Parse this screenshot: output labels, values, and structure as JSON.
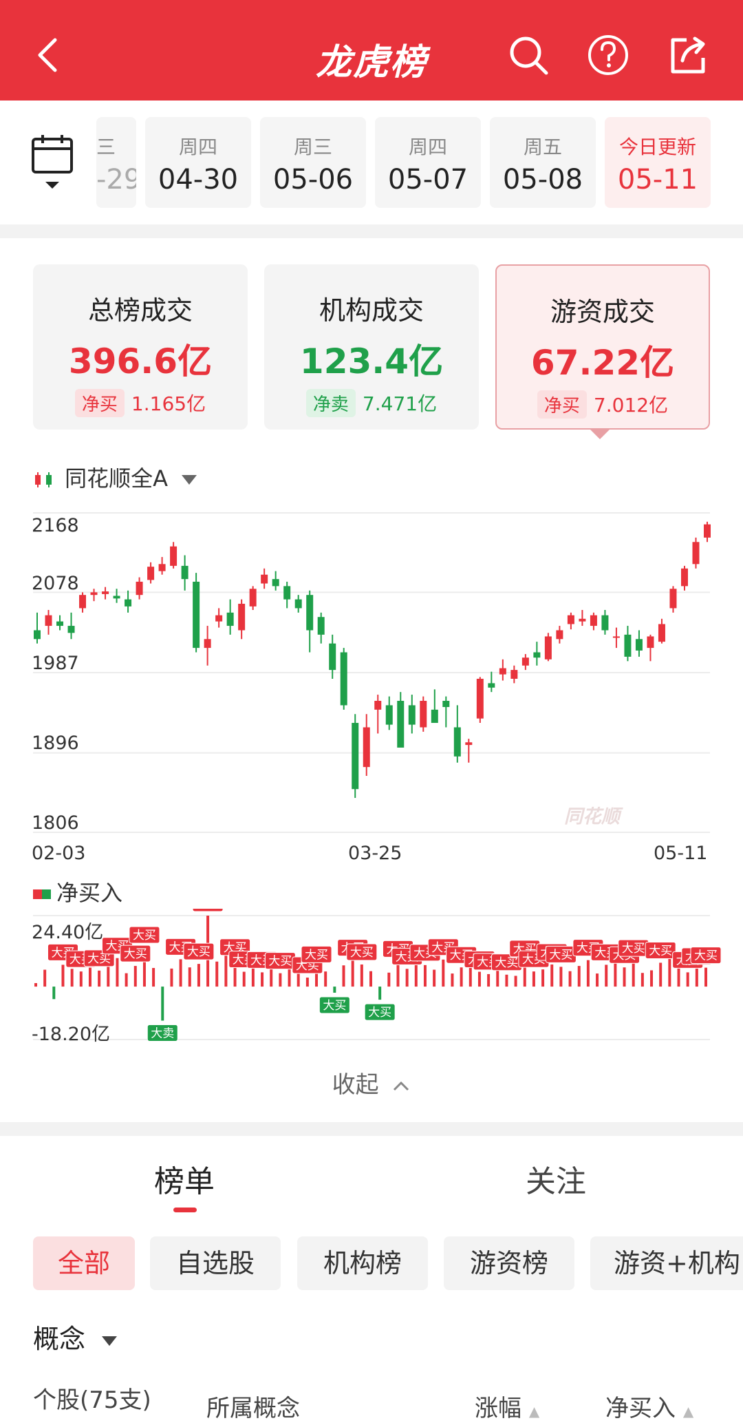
{
  "header": {
    "title": "龙虎榜",
    "back_icon": "back-arrow-icon",
    "icons": [
      "search-icon",
      "help-icon",
      "share-icon"
    ]
  },
  "dates": [
    {
      "week": "三",
      "date": "-29"
    },
    {
      "week": "周四",
      "date": "04-30"
    },
    {
      "week": "周三",
      "date": "05-06"
    },
    {
      "week": "周四",
      "date": "05-07"
    },
    {
      "week": "周五",
      "date": "05-08"
    },
    {
      "week": "今日更新",
      "date": "05-11"
    }
  ],
  "cards": [
    {
      "title": "总榜成交",
      "value": "396.6亿",
      "net_label": "净买",
      "net_value": "1.165亿"
    },
    {
      "title": "机构成交",
      "value": "123.4亿",
      "net_label": "净卖",
      "net_value": "7.471亿"
    },
    {
      "title": "游资成交",
      "value": "67.22亿",
      "net_label": "净买",
      "net_value": "7.012亿"
    }
  ],
  "index_selector": "同花顺全A",
  "watermark": "同花顺",
  "flow_label": "净买入",
  "collapse_label": "收起",
  "list_tabs": [
    "榜单",
    "关注"
  ],
  "filters": [
    "全部",
    "自选股",
    "机构榜",
    "游资榜",
    "游资+机构"
  ],
  "concept_label": "概念",
  "table_headers": [
    "个股(75支)",
    "所属概念",
    "涨幅",
    "净买入"
  ],
  "chart_data": [
    {
      "type": "candlestick",
      "title": "同花顺全A",
      "y_ticks": [
        "2168",
        "2078",
        "1987",
        "1896",
        "1806"
      ],
      "ylim": [
        1806,
        2168
      ],
      "x_ticks": [
        "02-03",
        "03-25",
        "05-11"
      ],
      "ohlc": [
        [
          2035,
          2055,
          2020,
          2025
        ],
        [
          2040,
          2058,
          2030,
          2052
        ],
        [
          2045,
          2052,
          2035,
          2040
        ],
        [
          2040,
          2055,
          2025,
          2032
        ],
        [
          2060,
          2078,
          2055,
          2075
        ],
        [
          2075,
          2082,
          2068,
          2078
        ],
        [
          2076,
          2084,
          2070,
          2079
        ],
        [
          2074,
          2082,
          2066,
          2071
        ],
        [
          2070,
          2080,
          2055,
          2062
        ],
        [
          2075,
          2095,
          2070,
          2090
        ],
        [
          2092,
          2112,
          2088,
          2107
        ],
        [
          2102,
          2118,
          2098,
          2110
        ],
        [
          2108,
          2135,
          2105,
          2130
        ],
        [
          2108,
          2120,
          2080,
          2093
        ],
        [
          2090,
          2100,
          2010,
          2015
        ],
        [
          2015,
          2040,
          1995,
          2025
        ],
        [
          2045,
          2060,
          2038,
          2052
        ],
        [
          2055,
          2070,
          2030,
          2040
        ],
        [
          2035,
          2070,
          2025,
          2065
        ],
        [
          2062,
          2085,
          2058,
          2082
        ],
        [
          2088,
          2105,
          2082,
          2098
        ],
        [
          2093,
          2102,
          2080,
          2085
        ],
        [
          2085,
          2090,
          2060,
          2070
        ],
        [
          2070,
          2075,
          2055,
          2060
        ],
        [
          2075,
          2080,
          2010,
          2035
        ],
        [
          2050,
          2055,
          2020,
          2030
        ],
        [
          2020,
          2030,
          1980,
          1990
        ],
        [
          2010,
          2015,
          1945,
          1950
        ],
        [
          1930,
          1940,
          1845,
          1855
        ],
        [
          1880,
          1940,
          1870,
          1925
        ],
        [
          1945,
          1962,
          1918,
          1955
        ],
        [
          1950,
          1960,
          1922,
          1928
        ],
        [
          1955,
          1965,
          1918,
          1902
        ],
        [
          1950,
          1962,
          1918,
          1928
        ],
        [
          1925,
          1960,
          1920,
          1955
        ],
        [
          1945,
          1968,
          1935,
          1930
        ],
        [
          1955,
          1960,
          1925,
          1948
        ],
        [
          1925,
          1950,
          1885,
          1892
        ],
        [
          1905,
          1912,
          1885,
          1908
        ],
        [
          1935,
          1982,
          1930,
          1980
        ],
        [
          1975,
          1988,
          1965,
          1970
        ],
        [
          1985,
          2002,
          1978,
          1992
        ],
        [
          1980,
          1995,
          1975,
          1990
        ],
        [
          1995,
          2008,
          1990,
          2004
        ],
        [
          2010,
          2022,
          1995,
          2004
        ],
        [
          2002,
          2032,
          2000,
          2028
        ],
        [
          2025,
          2040,
          2020,
          2035
        ],
        [
          2042,
          2055,
          2036,
          2052
        ],
        [
          2045,
          2058,
          2040,
          2048
        ],
        [
          2040,
          2055,
          2035,
          2052
        ],
        [
          2052,
          2058,
          2030,
          2035
        ],
        [
          2028,
          2038,
          2015,
          2028
        ],
        [
          2030,
          2040,
          2000,
          2005
        ],
        [
          2025,
          2035,
          2005,
          2012
        ],
        [
          2015,
          2030,
          2000,
          2028
        ],
        [
          2022,
          2048,
          2020,
          2042
        ],
        [
          2060,
          2085,
          2055,
          2082
        ],
        [
          2085,
          2108,
          2080,
          2105
        ],
        [
          2110,
          2140,
          2105,
          2135
        ],
        [
          2140,
          2158,
          2135,
          2155
        ]
      ]
    },
    {
      "type": "bar",
      "title": "净买入",
      "y_ticks": [
        "24.40亿",
        "-18.20亿"
      ],
      "ylim": [
        -18.2,
        24.4
      ],
      "values": [
        1.2,
        5.8,
        -4.3,
        7.5,
        6.1,
        5.2,
        6.8,
        5.5,
        8.3,
        9.8,
        4.6,
        7.1,
        13.5,
        6.4,
        -11.7,
        6.2,
        9.4,
        6.6,
        7.8,
        24.4,
        8.6,
        12.4,
        9.3,
        5.1,
        7.8,
        4.9,
        8.2,
        4.6,
        6.4,
        4.4,
        3.1,
        6.8,
        5.2,
        -2.1,
        7.3,
        9.1,
        7.6,
        5.3,
        -4.5,
        4.8,
        8.7,
        6.1,
        11.6,
        7.4,
        5.8,
        9.3,
        4.5,
        6.6,
        7.9,
        5.1,
        4.3,
        9.7,
        4.1,
        3.7,
        8.8,
        5.2,
        5.9,
        7.6,
        6.8,
        5.3,
        7.1,
        9.1,
        4.5,
        7.5,
        10.2,
        6.6,
        9.0,
        4.7,
        5.6,
        8.2,
        9.6,
        8.8,
        4.9,
        6.2,
        6.5
      ],
      "tags": [
        {
          "i": 3,
          "label": "大买"
        },
        {
          "i": 5,
          "label": "大买"
        },
        {
          "i": 7,
          "label": "大买"
        },
        {
          "i": 9,
          "label": "大买"
        },
        {
          "i": 12,
          "label": "大买"
        },
        {
          "i": 11,
          "label": "大买"
        },
        {
          "i": 14,
          "label": "大卖"
        },
        {
          "i": 16,
          "label": "大买"
        },
        {
          "i": 18,
          "label": "大买"
        },
        {
          "i": 19,
          "label": "大买"
        },
        {
          "i": 22,
          "label": "大买"
        },
        {
          "i": 23,
          "label": "大买"
        },
        {
          "i": 25,
          "label": "大买"
        },
        {
          "i": 27,
          "label": "大买"
        },
        {
          "i": 30,
          "label": "大买"
        },
        {
          "i": 31,
          "label": "大买"
        },
        {
          "i": 33,
          "label": "大买"
        },
        {
          "i": 35,
          "label": "大买"
        },
        {
          "i": 36,
          "label": "大买"
        },
        {
          "i": 38,
          "label": "大买"
        },
        {
          "i": 40,
          "label": "大买"
        },
        {
          "i": 41,
          "label": "大买"
        },
        {
          "i": 43,
          "label": "大买"
        },
        {
          "i": 45,
          "label": "大买"
        },
        {
          "i": 47,
          "label": "大买"
        },
        {
          "i": 49,
          "label": "大买"
        },
        {
          "i": 50,
          "label": "大买"
        },
        {
          "i": 52,
          "label": "大买"
        },
        {
          "i": 54,
          "label": "大买"
        },
        {
          "i": 55,
          "label": "大买"
        },
        {
          "i": 57,
          "label": "大买"
        },
        {
          "i": 58,
          "label": "大买"
        },
        {
          "i": 61,
          "label": "大买"
        },
        {
          "i": 63,
          "label": "大买"
        },
        {
          "i": 65,
          "label": "大买"
        },
        {
          "i": 66,
          "label": "大买"
        },
        {
          "i": 69,
          "label": "大买"
        },
        {
          "i": 72,
          "label": "大买"
        },
        {
          "i": 73,
          "label": "大买"
        },
        {
          "i": 74,
          "label": "大买"
        }
      ]
    }
  ]
}
